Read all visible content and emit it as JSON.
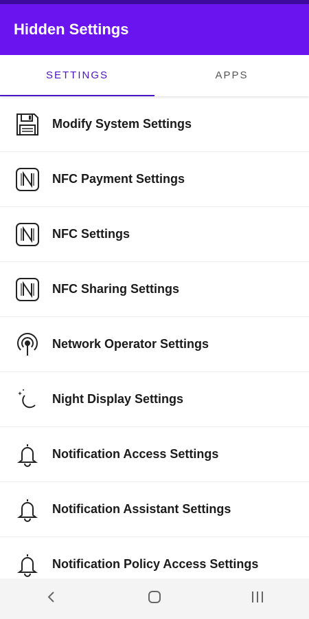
{
  "app": {
    "title": "Hidden Settings",
    "accent": "#6a14ef",
    "tab_accent": "#4a14c8"
  },
  "tabs": [
    {
      "label": "SETTINGS",
      "active": true
    },
    {
      "label": "APPS",
      "active": false
    }
  ],
  "settings": [
    {
      "label": "Modify System Settings",
      "icon": "floppy-disk-icon"
    },
    {
      "label": "NFC Payment Settings",
      "icon": "nfc-icon"
    },
    {
      "label": "NFC Settings",
      "icon": "nfc-icon"
    },
    {
      "label": "NFC Sharing Settings",
      "icon": "nfc-icon"
    },
    {
      "label": "Network Operator Settings",
      "icon": "signal-tower-icon"
    },
    {
      "label": "Night Display Settings",
      "icon": "moon-icon"
    },
    {
      "label": "Notification Access Settings",
      "icon": "bell-icon"
    },
    {
      "label": "Notification Assistant Settings",
      "icon": "bell-icon"
    },
    {
      "label": "Notification Policy Access Settings",
      "icon": "bell-icon"
    }
  ],
  "nav": [
    {
      "icon": "back-icon"
    },
    {
      "icon": "home-icon"
    },
    {
      "icon": "recents-icon"
    }
  ]
}
